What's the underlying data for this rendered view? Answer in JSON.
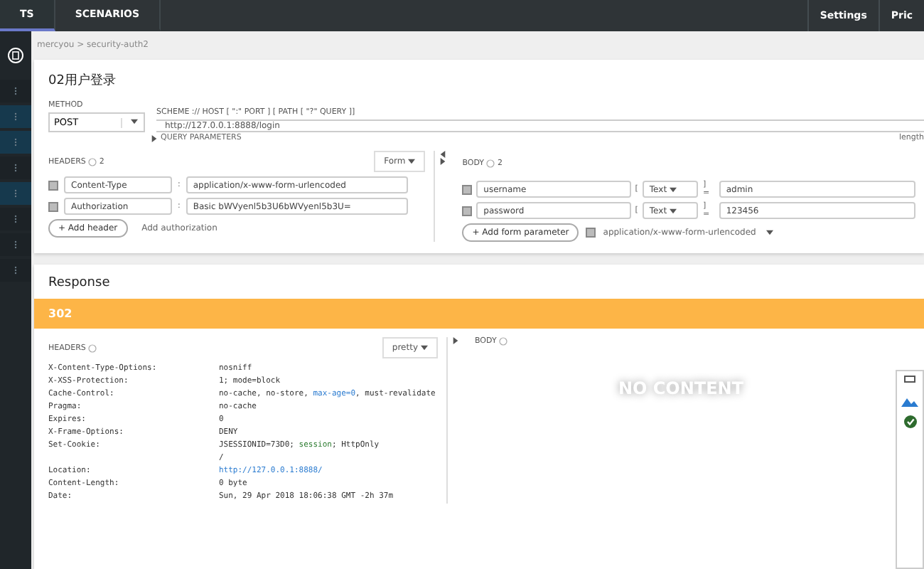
{
  "top_nav": {
    "tabs": [
      {
        "label": "TS",
        "selected": true
      },
      {
        "label": "SCENARIOS",
        "selected": false
      }
    ],
    "links": [
      "Settings",
      "Pric"
    ]
  },
  "sidebar": {
    "items": [
      {
        "selected": false
      },
      {
        "selected": true
      },
      {
        "selected": true
      },
      {
        "selected": false
      },
      {
        "selected": true
      },
      {
        "selected": false
      },
      {
        "selected": false
      },
      {
        "selected": false
      }
    ]
  },
  "breadcrumb": "mercyou > security-auth2",
  "request": {
    "title": "02用户登录",
    "method_label": "METHOD",
    "method": "POST",
    "url_label": "SCHEME :// HOST [ \":\" PORT ] [ PATH [ \"?\" QUERY ]]",
    "url": "http://127.0.0.1:8888/login",
    "length_label": "length",
    "query_toggle": "QUERY PARAMETERS",
    "headers": {
      "label": "HEADERS",
      "count": "2",
      "mode": "Form",
      "rows": [
        {
          "checked": true,
          "name": "Content-Type",
          "separator": ":",
          "value": "application/x-www-form-urlencoded"
        },
        {
          "checked": true,
          "name": "Authorization",
          "separator": ":",
          "value": "Basic bWVyenl5b3U6bWVyenl5b3U="
        }
      ],
      "add_button": "+ Add header",
      "auth_link": "Add authorization"
    },
    "body": {
      "label": "BODY",
      "count": "2",
      "rows": [
        {
          "checked": true,
          "name": "username",
          "open": "[",
          "type": "Text",
          "close": "] =",
          "value": "admin"
        },
        {
          "checked": true,
          "name": "password",
          "open": "[",
          "type": "Text",
          "close": "] =",
          "value": "123456"
        }
      ],
      "add_button": "+ Add form parameter",
      "encoding": {
        "checked": true,
        "label": "application/x-www-form-urlencoded"
      }
    }
  },
  "response": {
    "title": "Response",
    "status": "302",
    "headers_label": "HEADERS",
    "mode": "pretty",
    "body_label": "BODY",
    "body_empty": "NO CONTENT",
    "headers": [
      {
        "name": "X-Content-Type-Options:",
        "lines": [
          [
            {
              "kind": "plain",
              "text": "nosniff"
            }
          ]
        ]
      },
      {
        "name": "X-XSS-Protection:",
        "lines": [
          [
            {
              "kind": "plain",
              "text": "1; mode=block"
            }
          ]
        ]
      },
      {
        "name": "Cache-Control:",
        "lines": [
          [
            {
              "kind": "plain",
              "text": "no-cache, no-store, "
            },
            {
              "kind": "keyword",
              "text": "max-age=0"
            },
            {
              "kind": "plain",
              "text": ", must-revalidate"
            }
          ]
        ]
      },
      {
        "name": "Pragma:",
        "lines": [
          [
            {
              "kind": "plain",
              "text": "no-cache"
            }
          ]
        ]
      },
      {
        "name": "Expires:",
        "lines": [
          [
            {
              "kind": "plain",
              "text": "0"
            }
          ]
        ]
      },
      {
        "name": "X-Frame-Options:",
        "lines": [
          [
            {
              "kind": "plain",
              "text": "DENY"
            }
          ]
        ]
      },
      {
        "name": "Set-Cookie:",
        "lines": [
          [
            {
              "kind": "plain",
              "text": "JSESSIONID=73D0; "
            },
            {
              "kind": "flag",
              "text": "session"
            },
            {
              "kind": "plain",
              "text": "; HttpOnly"
            }
          ],
          [
            {
              "kind": "plain",
              "text": "/"
            }
          ]
        ]
      },
      {
        "name": "Location:",
        "lines": [
          [
            {
              "kind": "link",
              "text": "http://127.0.0.1:8888/"
            }
          ]
        ]
      },
      {
        "name": "Content-Length:",
        "lines": [
          [
            {
              "kind": "plain",
              "text": "0 byte"
            }
          ]
        ]
      },
      {
        "name": "Date:",
        "lines": [
          [
            {
              "kind": "plain",
              "text": "Sun, 29 Apr 2018 18:06:38 GMT -2h 37m"
            }
          ]
        ]
      }
    ]
  }
}
